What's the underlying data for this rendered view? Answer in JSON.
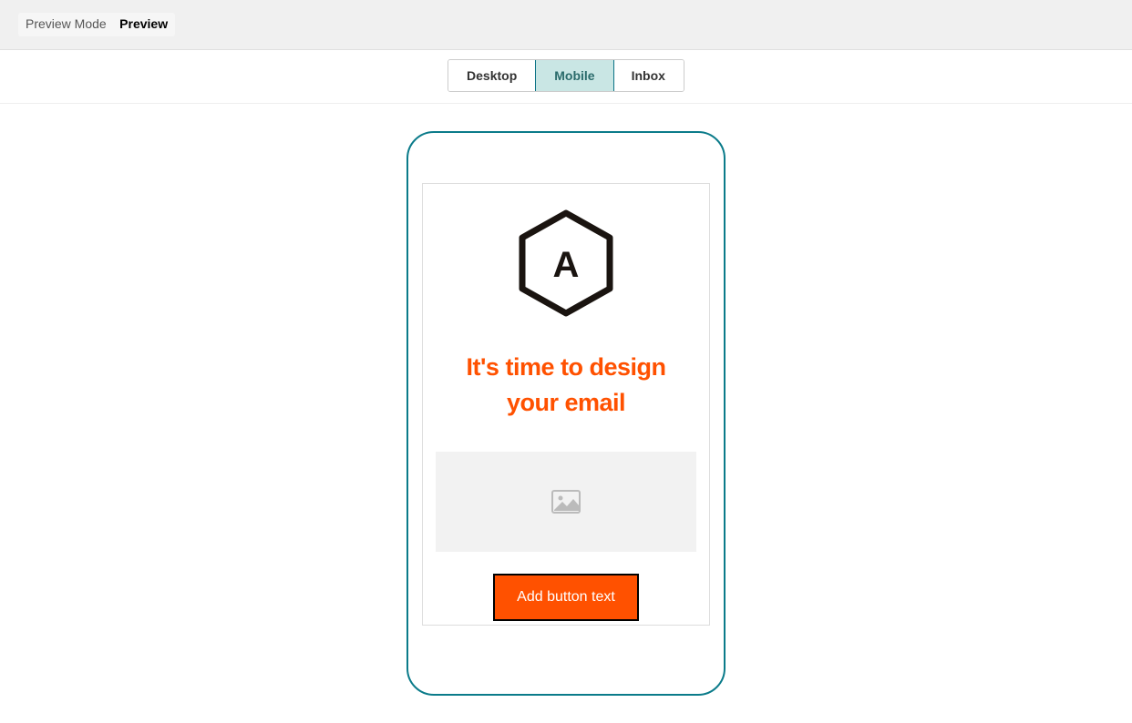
{
  "header": {
    "breadcrumb_label": "Preview Mode",
    "breadcrumb_value": "Preview"
  },
  "tabs": {
    "desktop": "Desktop",
    "mobile": "Mobile",
    "inbox": "Inbox",
    "active": "mobile"
  },
  "email": {
    "logo_letter": "A",
    "heading": "It's time to design your email",
    "button_text": "Add button text"
  },
  "colors": {
    "accent_orange": "#ff5100",
    "device_border": "#0b7b8a",
    "tab_active_bg": "#c9e6e4"
  }
}
